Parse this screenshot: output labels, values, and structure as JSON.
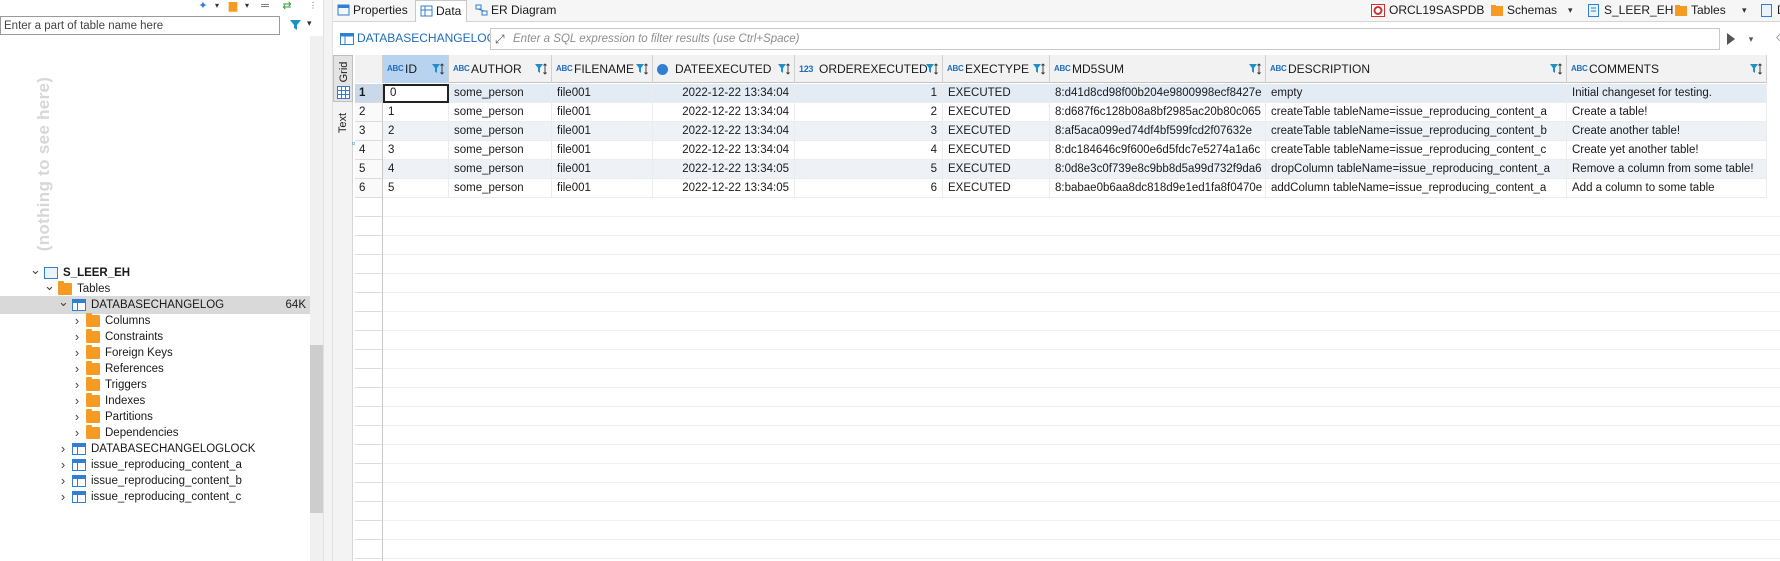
{
  "left_panel": {
    "filter_placeholder": "Enter a part of table name here",
    "empty_hint": "(nothing to see here)",
    "tree": [
      {
        "label": "S_LEER_EH",
        "level": 0,
        "chevron": "v",
        "icon": "schema",
        "bold": true
      },
      {
        "label": "Tables",
        "level": 1,
        "chevron": "v",
        "icon": "folder",
        "bold": false
      },
      {
        "label": "DATABASECHANGELOG",
        "level": 2,
        "chevron": "v",
        "icon": "table",
        "bold": false,
        "size": "64K",
        "selected": true
      },
      {
        "label": "Columns",
        "level": 3,
        "chevron": ">",
        "icon": "folder"
      },
      {
        "label": "Constraints",
        "level": 3,
        "chevron": ">",
        "icon": "folder"
      },
      {
        "label": "Foreign Keys",
        "level": 3,
        "chevron": ">",
        "icon": "folder"
      },
      {
        "label": "References",
        "level": 3,
        "chevron": ">",
        "icon": "folder"
      },
      {
        "label": "Triggers",
        "level": 3,
        "chevron": ">",
        "icon": "folder"
      },
      {
        "label": "Indexes",
        "level": 3,
        "chevron": ">",
        "icon": "folder"
      },
      {
        "label": "Partitions",
        "level": 3,
        "chevron": ">",
        "icon": "folder"
      },
      {
        "label": "Dependencies",
        "level": 3,
        "chevron": ">",
        "icon": "folder"
      },
      {
        "label": "DATABASECHANGELOGLOCK",
        "level": 2,
        "chevron": ">",
        "icon": "table"
      },
      {
        "label": "issue_reproducing_content_a",
        "level": 2,
        "chevron": ">",
        "icon": "table"
      },
      {
        "label": "issue_reproducing_content_b",
        "level": 2,
        "chevron": ">",
        "icon": "table"
      },
      {
        "label": "issue_reproducing_content_c",
        "level": 2,
        "chevron": ">",
        "icon": "table"
      }
    ]
  },
  "tabs": {
    "properties": "Properties",
    "data": "Data",
    "er_diagram": "ER Diagram"
  },
  "context": {
    "connection": "ORCL19SASPDB",
    "schemas": "Schemas",
    "schema": "S_LEER_EH",
    "tables": "Tables",
    "overflow": "D"
  },
  "results": {
    "table_name": "DATABASECHANGELOG",
    "filter_placeholder": "Enter a SQL expression to filter results (use Ctrl+Space)",
    "side_tabs": {
      "grid": "Grid",
      "text": "Text"
    },
    "columns": [
      {
        "name": "ID",
        "type": "ABC"
      },
      {
        "name": "AUTHOR",
        "type": "ABC"
      },
      {
        "name": "FILENAME",
        "type": "ABC"
      },
      {
        "name": "DATEEXECUTED",
        "type": "clock"
      },
      {
        "name": "ORDEREXECUTED",
        "type": "123"
      },
      {
        "name": "EXECTYPE",
        "type": "ABC"
      },
      {
        "name": "MD5SUM",
        "type": "ABC"
      },
      {
        "name": "DESCRIPTION",
        "type": "ABC"
      },
      {
        "name": "COMMENTS",
        "type": "ABC"
      }
    ],
    "rows": [
      {
        "num": "1",
        "cells": [
          "0",
          "some_person",
          "file001",
          "2022-12-22 13:34:04",
          "1",
          "EXECUTED",
          "8:d41d8cd98f00b204e9800998ecf8427e",
          "empty",
          "Initial changeset for testing."
        ]
      },
      {
        "num": "2",
        "cells": [
          "1",
          "some_person",
          "file001",
          "2022-12-22 13:34:04",
          "2",
          "EXECUTED",
          "8:d687f6c128b08a8bf2985ac20b80c065",
          "createTable tableName=issue_reproducing_content_a",
          "Create a table!"
        ]
      },
      {
        "num": "3",
        "cells": [
          "2",
          "some_person",
          "file001",
          "2022-12-22 13:34:04",
          "3",
          "EXECUTED",
          "8:af5aca099ed74df4bf599fcd2f07632e",
          "createTable tableName=issue_reproducing_content_b",
          "Create another table!"
        ]
      },
      {
        "num": "4",
        "cells": [
          "3",
          "some_person",
          "file001",
          "2022-12-22 13:34:04",
          "4",
          "EXECUTED",
          "8:dc184646c9f600e6d5fdc7e5274a1a6c",
          "createTable tableName=issue_reproducing_content_c",
          "Create yet another table!"
        ]
      },
      {
        "num": "5",
        "cells": [
          "4",
          "some_person",
          "file001",
          "2022-12-22 13:34:05",
          "5",
          "EXECUTED",
          "8:0d8e3c0f739e8c9bb8d5a99d732f9da6",
          "dropColumn tableName=issue_reproducing_content_a",
          "Remove a column from some table!"
        ]
      },
      {
        "num": "6",
        "cells": [
          "5",
          "some_person",
          "file001",
          "2022-12-22 13:34:05",
          "6",
          "EXECUTED",
          "8:babae0b6aa8dc818d9e1ed1fa8f0470e",
          "addColumn tableName=issue_reproducing_content_a",
          "Add a column to some table"
        ]
      }
    ]
  },
  "colors": {
    "accent_blue": "#2f7fd3",
    "folder_orange": "#f59a23",
    "selected_header": "#b7d3ef",
    "filter_funnel": "#1f8fc9"
  }
}
